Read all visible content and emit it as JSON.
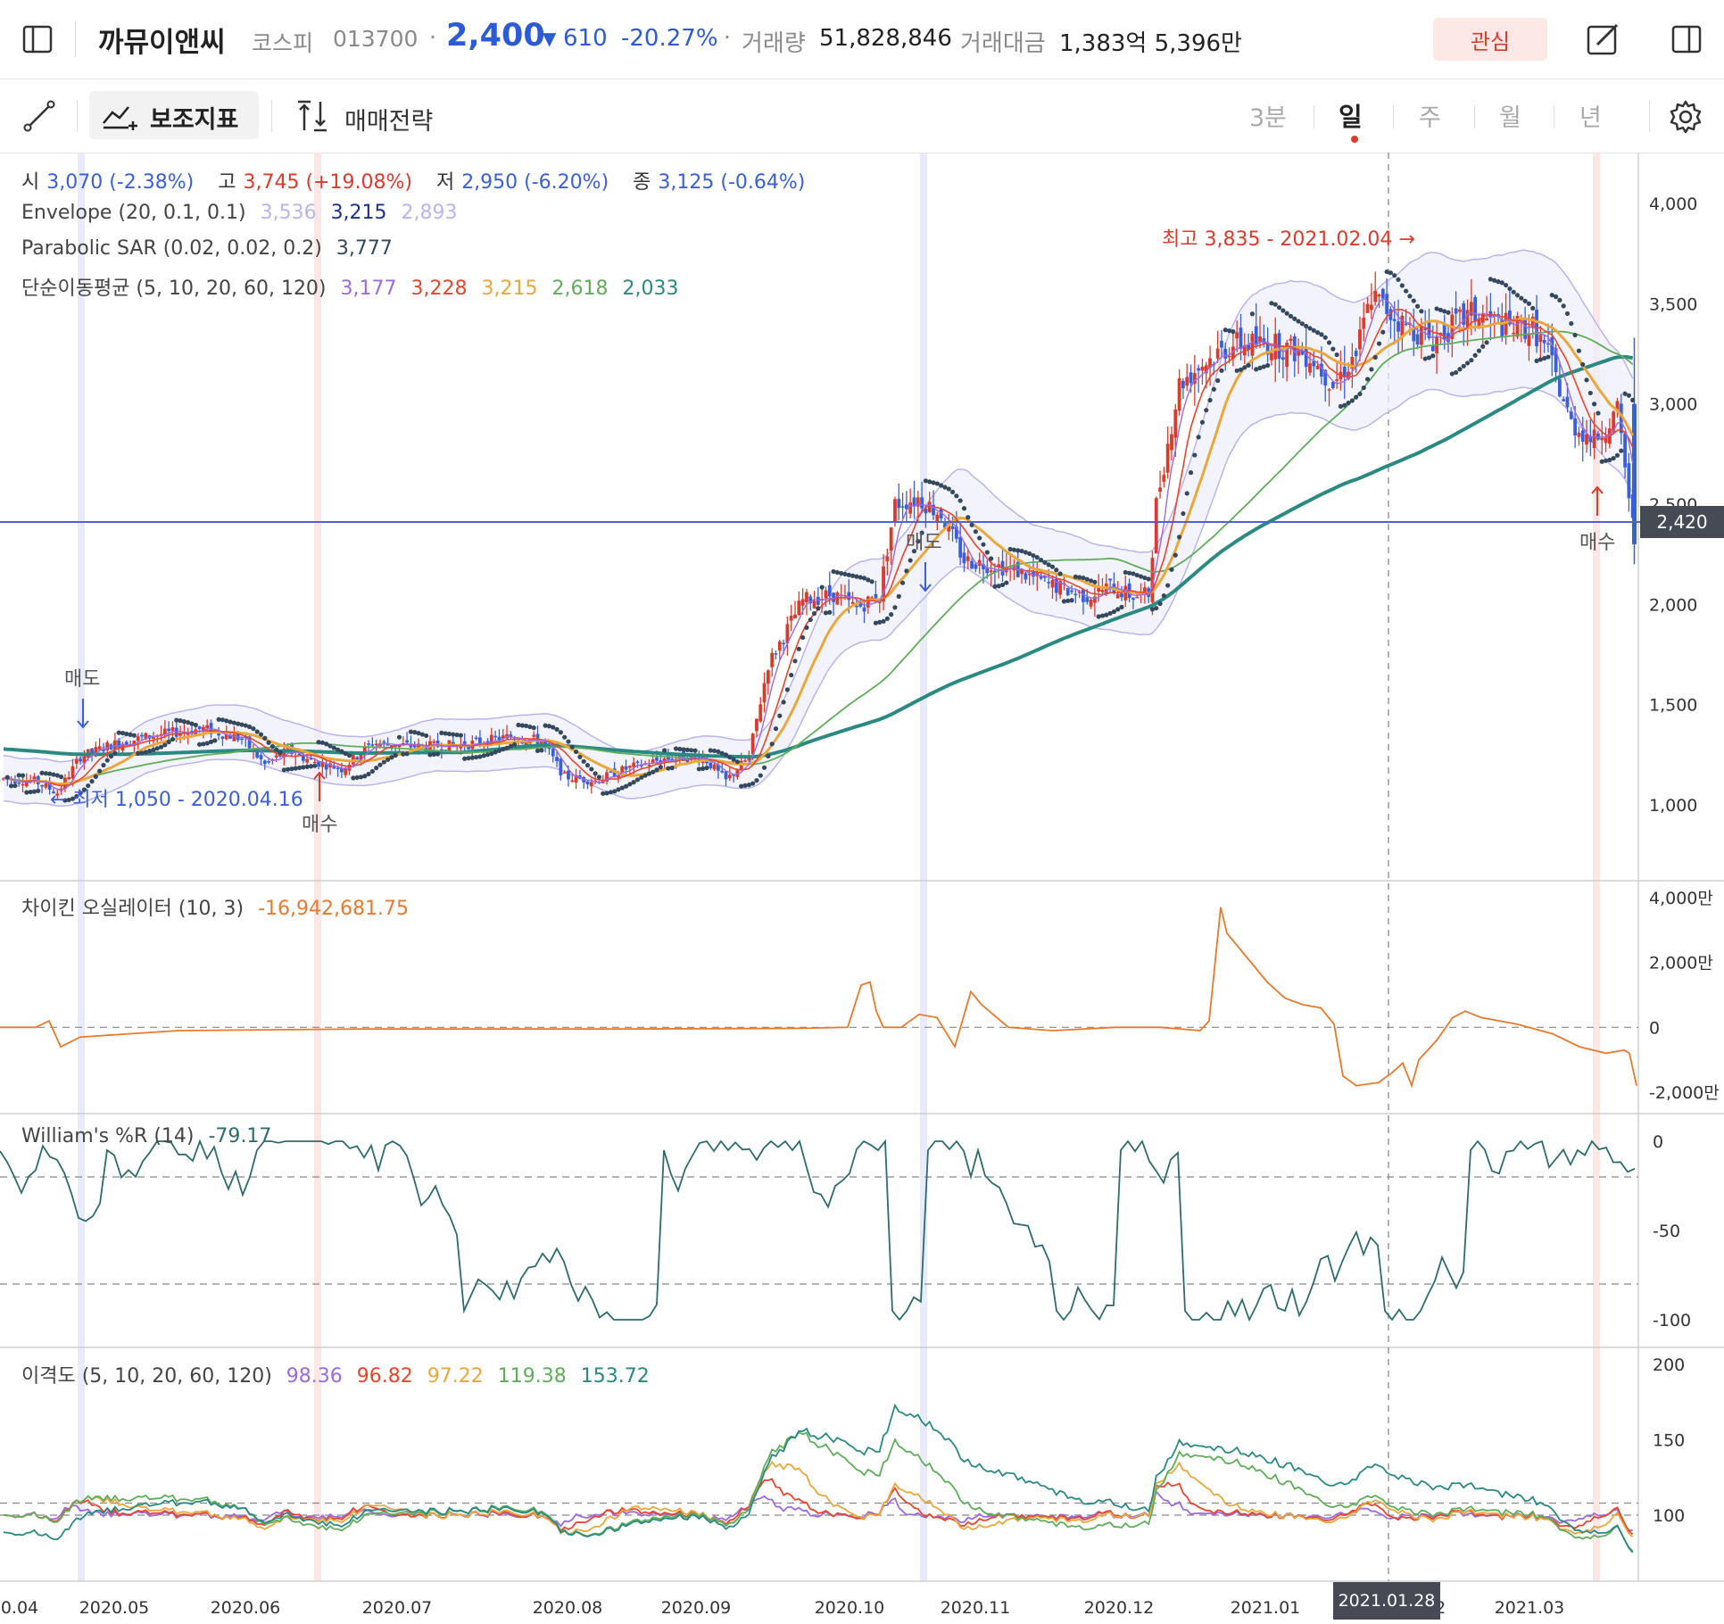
{
  "header": {
    "stock_name": "까뮤이앤씨",
    "market": "코스피",
    "code": "013700",
    "dot": "·",
    "price": "2,400",
    "change_arrow": "▼",
    "change": "610",
    "change_pct": "-20.27%",
    "volume_label": "거래량",
    "volume": "51,828,846",
    "amount_label": "거래대금",
    "amount": "1,383억 5,396만",
    "watch_label": "관심",
    "colors": {
      "down": "#2d5bd7",
      "up": "#d93b2c",
      "watch_bg": "#fde8e8"
    }
  },
  "toolbar": {
    "indicator_label": "보조지표",
    "strategy_label": "매매전략",
    "periods": [
      "3분",
      "일",
      "주",
      "월",
      "년"
    ],
    "active_period": "일"
  },
  "legend": {
    "ohlc": {
      "open_label": "시",
      "open": "3,070 (-2.38%)",
      "high_label": "고",
      "high": "3,745 (+19.08%)",
      "low_label": "저",
      "low": "2,950 (-6.20%)",
      "close_label": "종",
      "close": "3,125 (-0.64%)"
    },
    "envelope": {
      "name": "Envelope (20, 0.1, 0.1)",
      "upper": "3,536",
      "mid": "3,215",
      "lower": "2,893"
    },
    "psar": {
      "name": "Parabolic SAR (0.02, 0.02, 0.2)",
      "value": "3,777"
    },
    "sma": {
      "name": "단순이동평균 (5, 10, 20, 60, 120)",
      "values": [
        "3,177",
        "3,228",
        "3,215",
        "2,618",
        "2,033"
      ]
    },
    "chaikin": {
      "name": "차이킨 오실레이터 (10, 3)",
      "value": "-16,942,681.75"
    },
    "williams": {
      "name": "William's %R (14)",
      "value": "-79.17"
    },
    "disparity": {
      "name": "이격도 (5, 10, 20, 60, 120)",
      "values": [
        "98.36",
        "96.82",
        "97.22",
        "119.38",
        "153.72"
      ]
    }
  },
  "annotations": {
    "high": "최고 3,835 - 2021.02.04 →",
    "low": "← 최저 1,050 - 2020.04.16",
    "sell1": "매도",
    "sell2": "매도",
    "buy1": "매수",
    "buy2": "매수",
    "current_price_tag": "2,420",
    "crosshair_date": "2021.01.28"
  },
  "axes": {
    "price_ticks": [
      "4,000",
      "3,500",
      "3,000",
      "2,500",
      "2,000",
      "1,500",
      "1,000"
    ],
    "chaikin_ticks": [
      "4,000만",
      "2,000만",
      "0",
      "-2,000만"
    ],
    "williams_ticks": [
      "0",
      "-50",
      "-100"
    ],
    "disparity_ticks": [
      "200",
      "150",
      "100"
    ],
    "x_ticks": [
      "0.04",
      "2020.05",
      "2020.06",
      "2020.07",
      "2020.08",
      "2020.09",
      "2020.10",
      "2020.11",
      "2020.12",
      "2021.01",
      "2021.02",
      "2021.03"
    ]
  },
  "colors": {
    "up": "#d93b2c",
    "down": "#3a5fd9",
    "sma5": "#9b6ae0",
    "sma10": "#e8452c",
    "sma20": "#e9a73c",
    "sma60": "#5fad5b",
    "sma120": "#2a8a82",
    "envelope": "#b9b4ee",
    "psar": "#34495e",
    "chaikin": "#e67a2e",
    "williams": "#2f6b6a"
  },
  "chart_data": [
    {
      "type": "candlestick",
      "title": "까뮤이앤씨",
      "x_range": [
        "2020.04",
        "2021.03"
      ],
      "ylim": [
        800,
        4200
      ],
      "series": [
        {
          "name": "시",
          "values": [
            3070
          ]
        },
        {
          "name": "고",
          "values": [
            3745
          ]
        },
        {
          "name": "저",
          "values": [
            2950
          ]
        },
        {
          "name": "종",
          "values": [
            3125
          ]
        },
        {
          "name": "Envelope (20, 0.1, 0.1)",
          "values": [
            3536,
            3215,
            2893
          ]
        },
        {
          "name": "Parabolic SAR (0.02, 0.02, 0.2)",
          "values": [
            3777
          ]
        },
        {
          "name": "단순이동평균 (5, 10, 20, 60, 120)",
          "values": [
            3177,
            3228,
            3215,
            2618,
            2033
          ]
        }
      ],
      "annotations": [
        {
          "label": "최고 3,835 - 2021.02.04",
          "x": "2021.02.04",
          "y": 3835
        },
        {
          "label": "최저 1,050 - 2020.04.16",
          "x": "2020.04.16",
          "y": 1050
        },
        {
          "label": "current",
          "y": 2420
        }
      ]
    },
    {
      "type": "line",
      "title": "차이킨 오실레이터 (10, 3)",
      "ylim": [
        -25000000,
        42000000
      ],
      "series": [
        {
          "name": "차이킨 오실레이터 (10, 3)",
          "values": [
            -16942681.75
          ]
        }
      ]
    },
    {
      "type": "line",
      "title": "William's %R (14)",
      "ylim": [
        -105,
        5
      ],
      "series": [
        {
          "name": "William's %R (14)",
          "values": [
            -79.17
          ]
        }
      ]
    },
    {
      "type": "line",
      "title": "이격도 (5, 10, 20, 60, 120)",
      "ylim": [
        70,
        205
      ],
      "series": [
        {
          "name": "5",
          "values": [
            98.36
          ]
        },
        {
          "name": "10",
          "values": [
            96.82
          ]
        },
        {
          "name": "20",
          "values": [
            97.22
          ]
        },
        {
          "name": "60",
          "values": [
            119.38
          ]
        },
        {
          "name": "120",
          "values": [
            153.72
          ]
        }
      ]
    }
  ]
}
